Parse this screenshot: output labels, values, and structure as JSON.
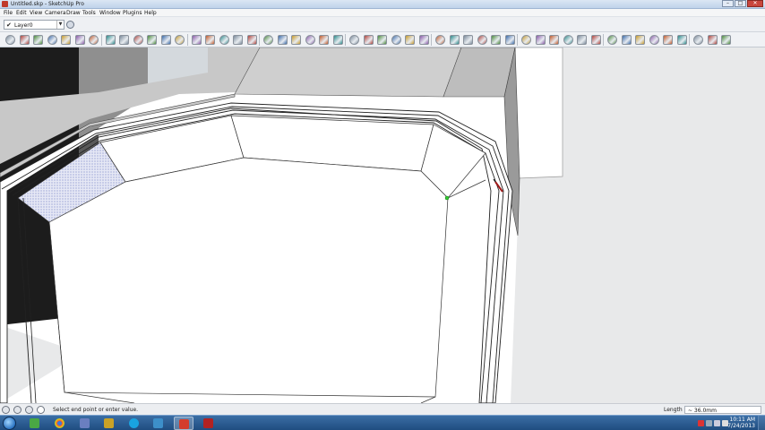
{
  "window": {
    "title": "Untitled.skp - SketchUp Pro",
    "minimize": "–",
    "maximize": "□",
    "close": "✕"
  },
  "menu": [
    "File",
    "Edit",
    "View",
    "Camera",
    "Draw",
    "Tools",
    "Window",
    "Plugins",
    "Help"
  ],
  "layer": {
    "check": "✔",
    "name": "Layer0",
    "arrow": "▼"
  },
  "toolbar_icons": [
    "iso-view-icon",
    "top-view-icon",
    "front-view-icon",
    "right-view-icon",
    "back-view-icon",
    "left-view-icon",
    "xray-icon",
    "hidden-line-icon",
    "shaded-icon",
    "textured-icon",
    "monochrome-icon",
    "wireframe-icon",
    "back-edges-icon",
    "paint-bucket-icon",
    "components-icon",
    "section-plane-icon",
    "section-display-icon",
    "section-cut-icon",
    "line-icon",
    "arc-icon",
    "freehand-icon",
    "rectangle-icon",
    "circle-icon",
    "polygon-icon",
    "push-pull-icon",
    "offset-icon",
    "follow-me-icon",
    "move-icon",
    "rotate-icon",
    "scale-icon",
    "tape-measure-icon",
    "dimension-icon",
    "protractor-icon",
    "text-icon",
    "axes-icon",
    "3d-text-icon",
    "orbit-icon",
    "pan-icon",
    "zoom-icon",
    "zoom-window-icon",
    "zoom-extents-icon",
    "previous-view-icon",
    "walk-icon",
    "look-around-icon",
    "position-camera-icon",
    "sandbox-icon",
    "terrain-icon",
    "solar-icon",
    "get-models-icon",
    "share-model-icon",
    "extension-icon"
  ],
  "status": {
    "hint": "Select end point or enter value.",
    "measure_label": "Length",
    "measure_value": "~ 36.0mm"
  },
  "taskbar": {
    "time": "10:11 AM",
    "date": "7/24/2013"
  }
}
